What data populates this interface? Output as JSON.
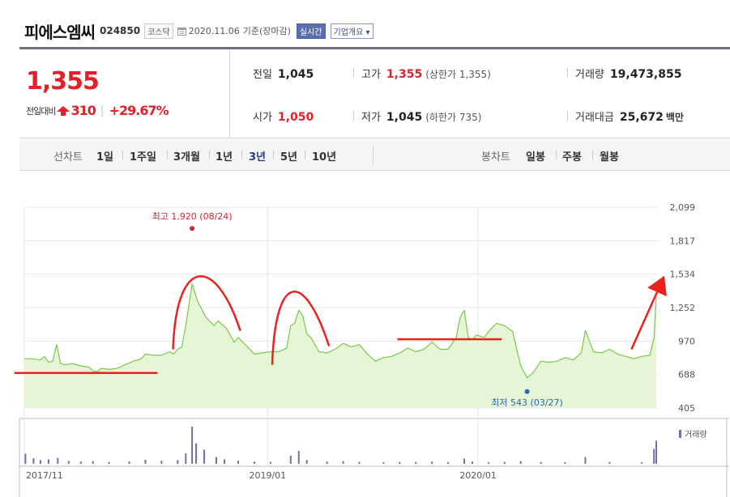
{
  "header": {
    "company_name": "피에스엠씨",
    "code": "024850",
    "market": "코스닥",
    "base_date": "2020.11.06",
    "base_label": "기준(장마감)",
    "realtime_label": "실시간",
    "profile_label": "기업개요"
  },
  "summary": {
    "current_price": "1,355",
    "change_label": "전일대비",
    "change_value": "310",
    "change_rate": "+29.67%",
    "prev_close_label": "전일",
    "prev_close": "1,045",
    "high_label": "고가",
    "high": "1,355",
    "upper_limit": "(상한가 1,355)",
    "volume_label": "거래량",
    "volume": "19,473,855",
    "open_label": "시가",
    "open": "1,050",
    "low_label": "저가",
    "low": "1,045",
    "lower_limit": "(하한가 735)",
    "amount_label": "거래대금",
    "amount": "25,672",
    "amount_unit": "백만"
  },
  "period_bar": {
    "line_chart_title": "선차트",
    "line_periods": [
      "1일",
      "1주일",
      "3개월",
      "1년",
      "3년",
      "5년",
      "10년"
    ],
    "active_period": "3년",
    "candle_chart_title": "봉차트",
    "candle_periods": [
      "일봉",
      "주봉",
      "월봉"
    ]
  },
  "colors": {
    "price_up": "#e2202a",
    "line": "#79c84a",
    "area": "#e6f5d6",
    "volume_bar": "#7b6aa8",
    "annotation": "#e8231e",
    "low_marker": "#2c64b8",
    "active_period": "#2b3f8f"
  },
  "chart_data": {
    "type": "area",
    "y_ticks": [
      "2,099",
      "1,817",
      "1,534",
      "1,252",
      "970",
      "688",
      "405"
    ],
    "ylim": [
      405,
      2099
    ],
    "xlim": [
      "2017-11-06",
      "2020-11-06"
    ],
    "x_ticks": [
      {
        "date": "2017-11-06",
        "label": "2017/11"
      },
      {
        "date": "2019-01-02",
        "label": "2019/01"
      },
      {
        "date": "2020-01-02",
        "label": "2020/01"
      }
    ],
    "high_annotation": {
      "label": "최고 1,920 (08/24)",
      "date": "2018-08-24",
      "value": 1920
    },
    "low_annotation": {
      "label": "최저 543 (03/27)",
      "date": "2020-03-27",
      "value": 543
    },
    "volume_legend": "거래량",
    "grid": true,
    "series": [
      {
        "values": [
          [
            "2017-11-06",
            820
          ],
          [
            "2017-11-20",
            820
          ],
          [
            "2017-12-04",
            810
          ],
          [
            "2017-12-11",
            840
          ],
          [
            "2017-12-18",
            790
          ],
          [
            "2017-12-25",
            800
          ],
          [
            "2018-01-01",
            940
          ],
          [
            "2018-01-08",
            780
          ],
          [
            "2018-01-15",
            770
          ],
          [
            "2018-01-29",
            780
          ],
          [
            "2018-02-12",
            760
          ],
          [
            "2018-02-26",
            750
          ],
          [
            "2018-03-05",
            720
          ],
          [
            "2018-03-12",
            710
          ],
          [
            "2018-03-19",
            740
          ],
          [
            "2018-04-02",
            730
          ],
          [
            "2018-04-16",
            740
          ],
          [
            "2018-04-30",
            770
          ],
          [
            "2018-05-14",
            800
          ],
          [
            "2018-05-28",
            820
          ],
          [
            "2018-06-04",
            860
          ],
          [
            "2018-06-18",
            850
          ],
          [
            "2018-07-02",
            850
          ],
          [
            "2018-07-16",
            880
          ],
          [
            "2018-07-23",
            860
          ],
          [
            "2018-07-30",
            900
          ],
          [
            "2018-08-06",
            920
          ],
          [
            "2018-08-13",
            1100
          ],
          [
            "2018-08-24",
            1450
          ],
          [
            "2018-09-03",
            1300
          ],
          [
            "2018-09-17",
            1170
          ],
          [
            "2018-10-01",
            1100
          ],
          [
            "2018-10-08",
            1140
          ],
          [
            "2018-10-22",
            1080
          ],
          [
            "2018-11-05",
            960
          ],
          [
            "2018-11-12",
            1000
          ],
          [
            "2018-11-26",
            930
          ],
          [
            "2018-12-10",
            860
          ],
          [
            "2018-12-24",
            870
          ],
          [
            "2019-01-07",
            880
          ],
          [
            "2019-01-21",
            880
          ],
          [
            "2019-02-04",
            910
          ],
          [
            "2019-02-11",
            1100
          ],
          [
            "2019-02-18",
            1120
          ],
          [
            "2019-02-25",
            1230
          ],
          [
            "2019-03-04",
            1180
          ],
          [
            "2019-03-11",
            1030
          ],
          [
            "2019-03-18",
            1000
          ],
          [
            "2019-04-01",
            880
          ],
          [
            "2019-04-15",
            870
          ],
          [
            "2019-04-29",
            900
          ],
          [
            "2019-05-13",
            950
          ],
          [
            "2019-05-27",
            920
          ],
          [
            "2019-06-10",
            940
          ],
          [
            "2019-06-24",
            860
          ],
          [
            "2019-07-08",
            800
          ],
          [
            "2019-07-22",
            830
          ],
          [
            "2019-08-05",
            840
          ],
          [
            "2019-08-19",
            870
          ],
          [
            "2019-09-02",
            910
          ],
          [
            "2019-09-16",
            880
          ],
          [
            "2019-09-30",
            900
          ],
          [
            "2019-10-14",
            960
          ],
          [
            "2019-10-28",
            900
          ],
          [
            "2019-11-11",
            900
          ],
          [
            "2019-11-25",
            1000
          ],
          [
            "2019-12-02",
            1170
          ],
          [
            "2019-12-09",
            1230
          ],
          [
            "2019-12-16",
            1000
          ],
          [
            "2019-12-23",
            980
          ],
          [
            "2019-12-30",
            1020
          ],
          [
            "2020-01-13",
            1000
          ],
          [
            "2020-01-20",
            1050
          ],
          [
            "2020-02-03",
            1120
          ],
          [
            "2020-02-17",
            1100
          ],
          [
            "2020-03-02",
            1050
          ],
          [
            "2020-03-09",
            900
          ],
          [
            "2020-03-16",
            760
          ],
          [
            "2020-03-27",
            660
          ],
          [
            "2020-04-06",
            700
          ],
          [
            "2020-04-20",
            800
          ],
          [
            "2020-05-04",
            790
          ],
          [
            "2020-05-18",
            800
          ],
          [
            "2020-06-01",
            830
          ],
          [
            "2020-06-15",
            810
          ],
          [
            "2020-06-29",
            870
          ],
          [
            "2020-07-06",
            1060
          ],
          [
            "2020-07-20",
            880
          ],
          [
            "2020-08-03",
            870
          ],
          [
            "2020-08-17",
            900
          ],
          [
            "2020-08-31",
            860
          ],
          [
            "2020-09-14",
            840
          ],
          [
            "2020-09-28",
            820
          ],
          [
            "2020-10-12",
            840
          ],
          [
            "2020-10-26",
            850
          ],
          [
            "2020-11-02",
            1000
          ],
          [
            "2020-11-06",
            1355
          ]
        ]
      },
      {
        "values": [
          [
            "2017-11-08",
            0.27
          ],
          [
            "2017-11-22",
            0.15
          ],
          [
            "2017-12-04",
            0.1
          ],
          [
            "2017-12-18",
            0.12
          ],
          [
            "2018-01-03",
            0.16
          ],
          [
            "2018-01-22",
            0.08
          ],
          [
            "2018-02-12",
            0.06
          ],
          [
            "2018-03-05",
            0.07
          ],
          [
            "2018-04-02",
            0.05
          ],
          [
            "2018-05-07",
            0.06
          ],
          [
            "2018-06-04",
            0.11
          ],
          [
            "2018-07-02",
            0.08
          ],
          [
            "2018-07-30",
            0.1
          ],
          [
            "2018-08-13",
            0.28
          ],
          [
            "2018-08-24",
            1.0
          ],
          [
            "2018-08-31",
            0.55
          ],
          [
            "2018-09-14",
            0.38
          ],
          [
            "2018-10-05",
            0.18
          ],
          [
            "2018-10-19",
            0.12
          ],
          [
            "2018-11-12",
            0.08
          ],
          [
            "2018-12-10",
            0.06
          ],
          [
            "2019-01-07",
            0.05
          ],
          [
            "2019-02-11",
            0.22
          ],
          [
            "2019-02-25",
            0.35
          ],
          [
            "2019-03-11",
            0.1
          ],
          [
            "2019-04-15",
            0.06
          ],
          [
            "2019-05-13",
            0.07
          ],
          [
            "2019-06-10",
            0.05
          ],
          [
            "2019-07-22",
            0.04
          ],
          [
            "2019-08-19",
            0.05
          ],
          [
            "2019-09-16",
            0.05
          ],
          [
            "2019-10-14",
            0.06
          ],
          [
            "2019-11-11",
            0.05
          ],
          [
            "2019-12-09",
            0.14
          ],
          [
            "2019-12-23",
            0.06
          ],
          [
            "2020-01-20",
            0.04
          ],
          [
            "2020-02-17",
            0.05
          ],
          [
            "2020-03-16",
            0.07
          ],
          [
            "2020-04-20",
            0.05
          ],
          [
            "2020-06-01",
            0.04
          ],
          [
            "2020-07-06",
            0.18
          ],
          [
            "2020-08-17",
            0.05
          ],
          [
            "2020-10-12",
            0.04
          ],
          [
            "2020-11-02",
            0.4
          ],
          [
            "2020-11-06",
            0.62
          ]
        ]
      }
    ],
    "annotations": [
      {
        "type": "hline",
        "y": 700,
        "x0": "2017-10-20",
        "x1": "2018-06-25"
      },
      {
        "type": "arc",
        "x0": "2018-07-22",
        "x1": "2018-11-15",
        "peak": 1555
      },
      {
        "type": "arc",
        "x0": "2019-01-10",
        "x1": "2019-04-18",
        "peak": 1425
      },
      {
        "type": "hline",
        "y": 985,
        "x0": "2019-08-15",
        "x1": "2020-02-12"
      },
      {
        "type": "arrow",
        "x0": "2020-09-24",
        "y0": 900,
        "x1": "2020-11-20",
        "y1": 1520
      }
    ]
  }
}
